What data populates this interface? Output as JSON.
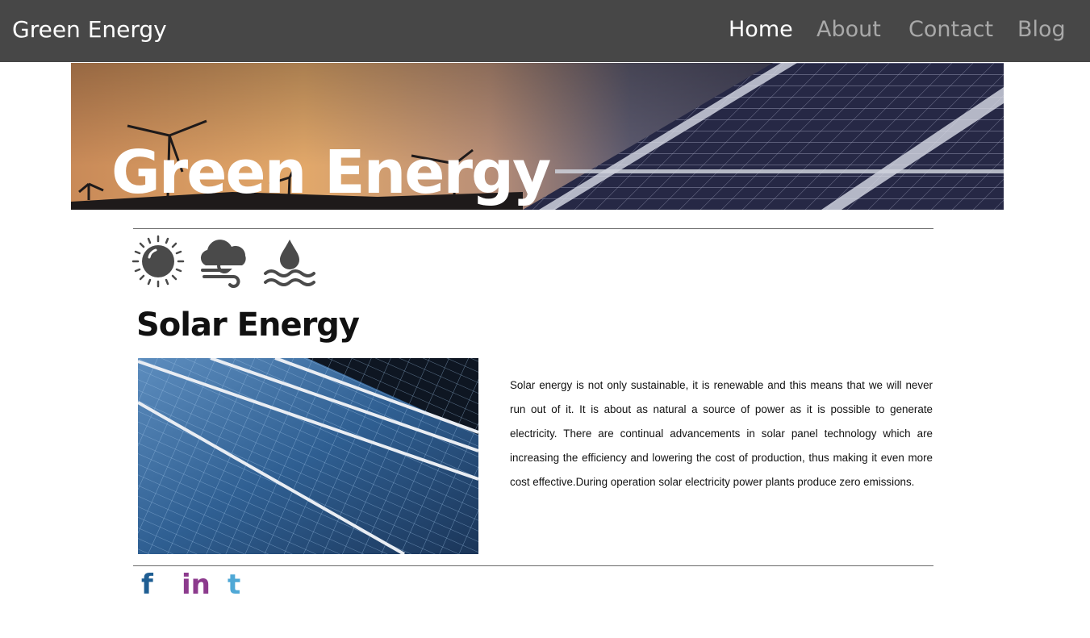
{
  "navbar": {
    "brand": "Green Energy",
    "links": [
      {
        "label": "Home",
        "active": true
      },
      {
        "label": "About",
        "active": false
      },
      {
        "label": "Contact",
        "active": false
      },
      {
        "label": "Blog",
        "active": false
      }
    ]
  },
  "hero": {
    "title": "Green Energy"
  },
  "icons": [
    "sun-icon",
    "cloud-wind-icon",
    "water-drop-icon"
  ],
  "section": {
    "title": "Solar Energy",
    "body": "Solar energy is not only sustainable, it is renewable and this means that we will never run out of it. It is about as natural a source of power as it is possible to generate electricity. There are continual advancements in solar panel technology which are increasing the efficiency and lowering the cost of production, thus making it even more cost effective.During operation solar electricity power plants produce zero emissions."
  },
  "social": [
    {
      "label": "f",
      "icon": "facebook-icon",
      "color": "#1f5e93"
    },
    {
      "label": "in",
      "icon": "linkedin-icon",
      "color": "#8c3a8d"
    },
    {
      "label": "t",
      "icon": "twitter-icon",
      "color": "#4fa8d6"
    }
  ],
  "colors": {
    "navbar_bg": "#474747",
    "nav_active": "#ffffff",
    "nav_inactive": "#a9a9a9"
  }
}
